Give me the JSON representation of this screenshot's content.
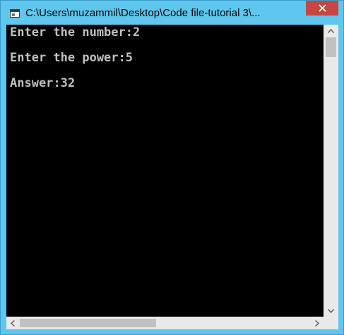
{
  "window": {
    "title": "C:\\Users\\muzammil\\Desktop\\Code file-tutorial 3\\...",
    "accent_color": "#5fc6ee",
    "close_color": "#c7463f"
  },
  "icons": {
    "app": "console-window-icon",
    "close": "close-icon",
    "up": "arrow-up-icon",
    "down": "arrow-down-icon",
    "left": "arrow-left-icon",
    "right": "arrow-right-icon"
  },
  "console": {
    "background": "#000000",
    "text_color": "#c0c0c0",
    "lines": [
      "Enter the number:2",
      "Enter the power:5",
      "Answer:32"
    ]
  }
}
